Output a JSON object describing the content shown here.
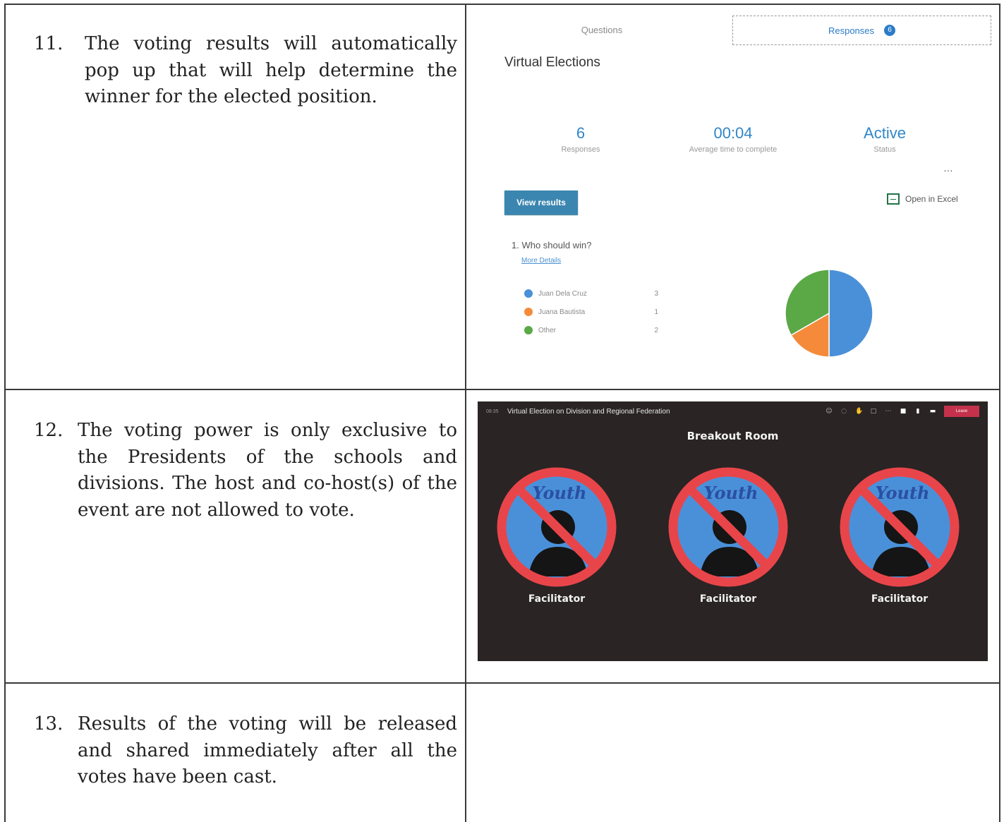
{
  "steps": [
    {
      "num": "11.",
      "text": "The voting results will automatically pop up that will help determine the winner for the elected position."
    },
    {
      "num": "12.",
      "text": "The voting power is only exclusive to the Presidents of the schools and divisions. The host and co-host(s) of the event are not allowed to vote."
    },
    {
      "num": "13.",
      "text": "Results of the voting will be released and shared immediately after all the votes have been cast."
    }
  ],
  "forms": {
    "tabs": {
      "questions": "Questions",
      "responses": "Responses",
      "badge": "6"
    },
    "title": "Virtual Elections",
    "stats": [
      {
        "value": "6",
        "label": "Responses"
      },
      {
        "value": "00:04",
        "label": "Average time to complete"
      },
      {
        "value": "Active",
        "label": "Status"
      }
    ],
    "more_icon": "…",
    "view_results": "View results",
    "open_excel": "Open in Excel",
    "question": "1.  Who should win?",
    "more_details": "More Details"
  },
  "chart_data": {
    "type": "pie",
    "categories": [
      "Juan Dela Cruz",
      "Juana Bautista",
      "Other"
    ],
    "values": [
      3,
      1,
      2
    ],
    "colors": [
      "#4a90d9",
      "#f58b3a",
      "#5aa846"
    ]
  },
  "teams": {
    "duration": "08:35",
    "title": "Virtual Election on Division and Regional Federation",
    "leave": "Leave",
    "room_title": "Breakout Room",
    "logo_text": "Youth",
    "participants": [
      "Facilitator",
      "Facilitator",
      "Facilitator"
    ]
  }
}
